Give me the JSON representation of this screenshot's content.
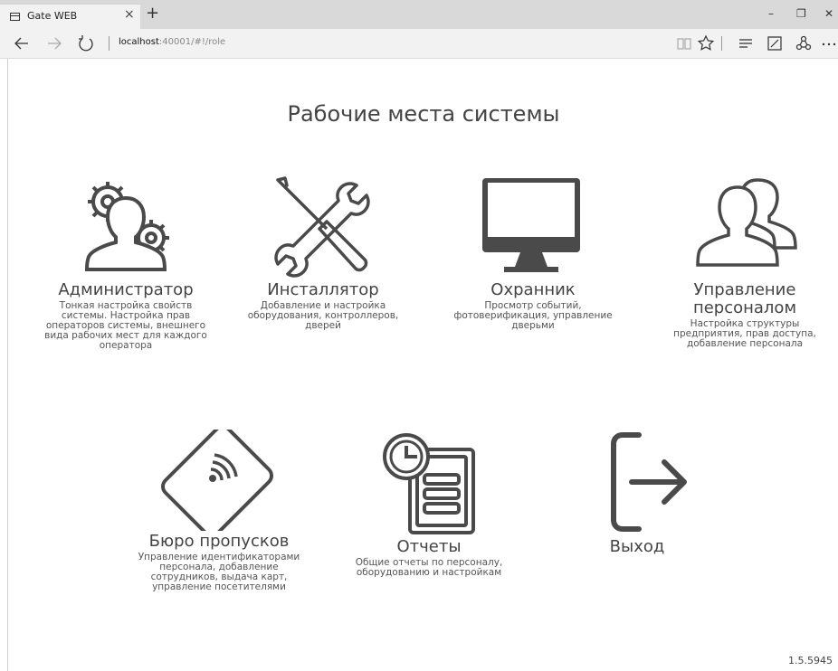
{
  "browser": {
    "tab_title": "Gate WEB",
    "tab_close": "×",
    "new_tab": "+",
    "url_host": "localhost",
    "url_path": ":40001/#!/role",
    "win_min": "–",
    "win_restore": "❐",
    "win_close": "✕"
  },
  "page": {
    "title": "Рабочие места системы",
    "version": "1.5.5945"
  },
  "roles": [
    {
      "name": "Администратор",
      "icon": "admin-gears-icon",
      "desc": "Тонкая настройка свойств системы. Настройка прав операторов системы, внешнего вида рабочих мест для каждого оператора"
    },
    {
      "name": "Инсталлятор",
      "icon": "wrench-screwdriver-icon",
      "desc": "Добавление и настройка оборудования, контроллеров, дверей"
    },
    {
      "name": "Охранник",
      "icon": "monitor-icon",
      "desc": "Просмотр событий, фотоверификация, управление дверьми"
    },
    {
      "name": "Управление персоналом",
      "icon": "users-icon",
      "desc": "Настройка структуры предприятия, прав доступа, добавление персонала"
    },
    {
      "name": "Бюро пропусков",
      "icon": "access-card-icon",
      "desc": "Управление идентификаторами персонала, добавление сотрудников, выдача карт, управление посетителями"
    },
    {
      "name": "Отчеты",
      "icon": "report-clock-icon",
      "desc": "Общие отчеты по персоналу, оборудованию и настройкам"
    },
    {
      "name": "Выход",
      "icon": "exit-icon",
      "desc": ""
    }
  ],
  "colors": {
    "icon": "#4a4a4a",
    "chrome": "#f2f2f2",
    "tabbar": "#d9d9d9"
  }
}
